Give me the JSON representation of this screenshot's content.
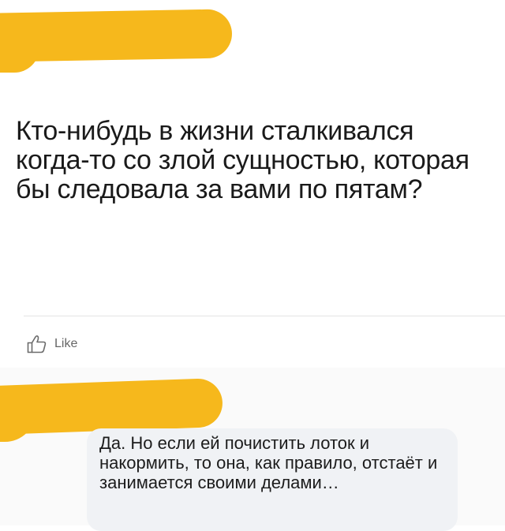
{
  "post": {
    "text": "Кто-нибудь в жизни сталкивался когда-то со злой сущностью, которая бы следовала за вами по пятам?"
  },
  "actions": {
    "like_label": "Like",
    "like_icon": "thumbs-up-icon"
  },
  "comment": {
    "text": "Да. Но если ей почистить лоток и накормить, то она, как правило, отстаёт и занимается своими делами…"
  },
  "colors": {
    "redaction": "#f6b81c",
    "bubble": "#f0f2f5",
    "text": "#1c1c1c"
  }
}
